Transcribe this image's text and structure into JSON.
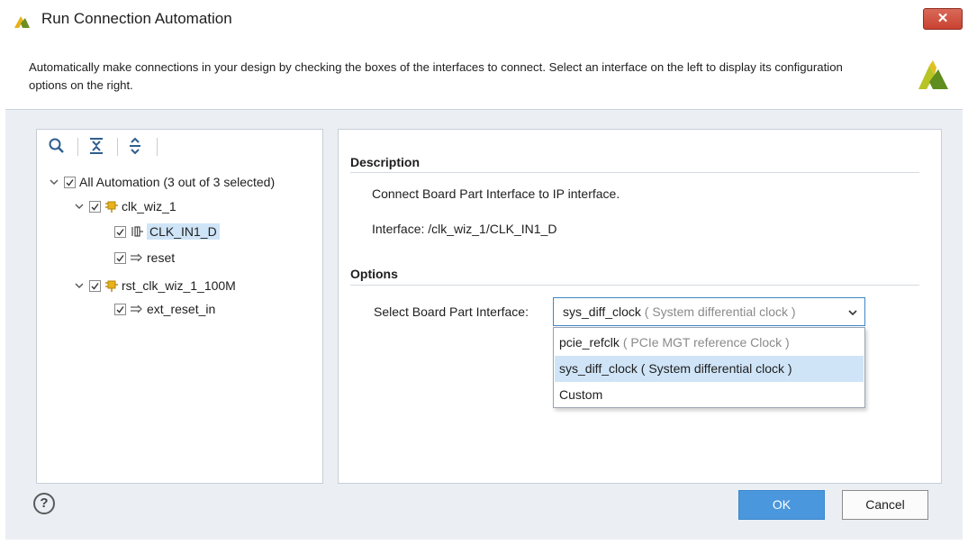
{
  "window": {
    "title": "Run Connection Automation",
    "close_symbol": "✕"
  },
  "header": {
    "description": "Automatically make connections in your design by checking the boxes of the interfaces to connect. Select an interface on the left to display its configuration options on the right."
  },
  "toolbar": {
    "icons": [
      "search-icon",
      "collapse-all-icon",
      "expand-all-icon"
    ]
  },
  "tree": {
    "items": [
      {
        "label": "All Automation (3 out of 3 selected)",
        "checked": true,
        "icon": "none",
        "level": 0,
        "expanded": true
      },
      {
        "label": "clk_wiz_1",
        "checked": true,
        "icon": "ip-block-icon",
        "level": 1,
        "expanded": true
      },
      {
        "label": "CLK_IN1_D",
        "checked": true,
        "icon": "differential-interface-icon",
        "level": 2,
        "selected": true
      },
      {
        "label": "reset",
        "checked": true,
        "icon": "port-arrow-icon",
        "level": 2
      },
      {
        "label": "rst_clk_wiz_1_100M",
        "checked": true,
        "icon": "ip-block-icon",
        "level": 1,
        "expanded": true
      },
      {
        "label": "ext_reset_in",
        "checked": true,
        "icon": "port-arrow-icon",
        "level": 2
      }
    ]
  },
  "details": {
    "description_heading": "Description",
    "description_text": "Connect Board Part Interface to IP interface.",
    "interface_text": "Interface: /clk_wiz_1/CLK_IN1_D",
    "options_heading": "Options",
    "select_label": "Select Board Part Interface:",
    "selected_value": "sys_diff_clock",
    "selected_hint": "( System differential clock )",
    "options": [
      {
        "value": "pcie_refclk",
        "hint": "( PCIe MGT reference Clock )"
      },
      {
        "value": "sys_diff_clock",
        "hint": "( System differential clock )",
        "selected": true
      },
      {
        "value": "Custom",
        "hint": ""
      }
    ]
  },
  "footer": {
    "help_symbol": "?",
    "ok_label": "OK",
    "cancel_label": "Cancel"
  },
  "colors": {
    "accent": "#4a97dd",
    "selection": "#cfe4f7",
    "ip_icon": "#e8b21a",
    "close": "#c9422f"
  }
}
